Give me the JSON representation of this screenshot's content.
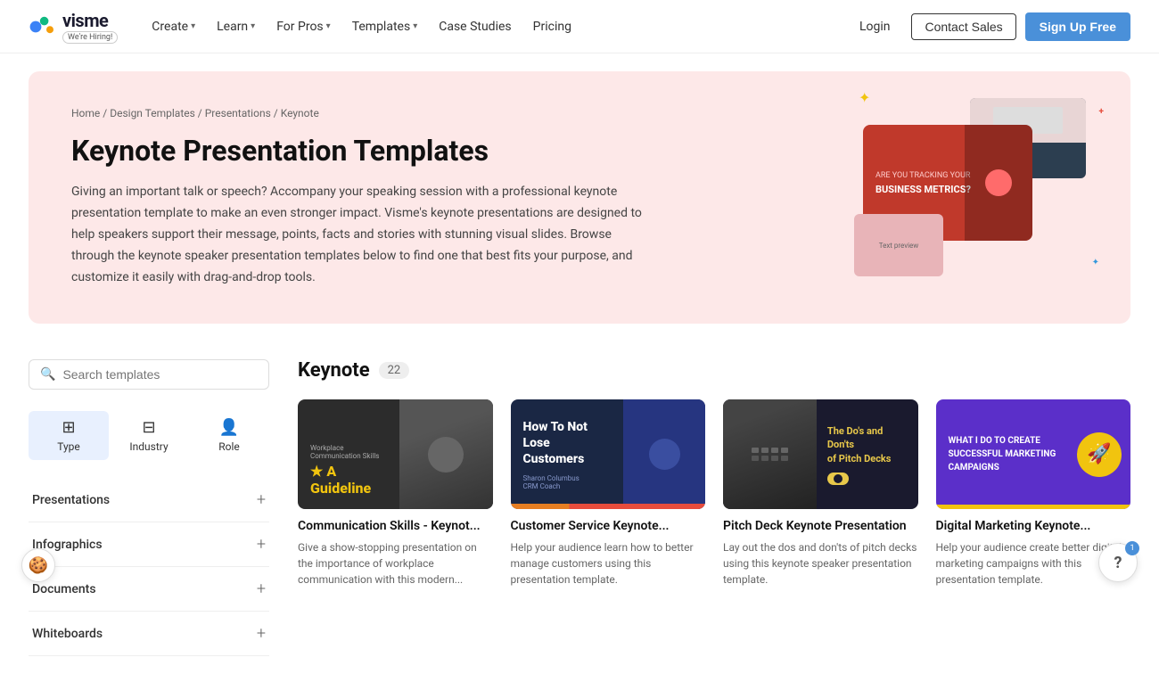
{
  "brand": {
    "name": "visme",
    "hiring_badge": "We're Hiring!",
    "logo_emoji": "🦎"
  },
  "nav": {
    "items": [
      {
        "label": "Create",
        "has_dropdown": true
      },
      {
        "label": "Learn",
        "has_dropdown": true
      },
      {
        "label": "For Pros",
        "has_dropdown": true
      },
      {
        "label": "Templates",
        "has_dropdown": true
      },
      {
        "label": "Case Studies",
        "has_dropdown": false
      },
      {
        "label": "Pricing",
        "has_dropdown": false
      }
    ],
    "login": "Login",
    "contact_sales": "Contact Sales",
    "sign_up": "Sign Up Free"
  },
  "hero": {
    "breadcrumb": [
      "Home",
      "Design Templates",
      "Presentations",
      "Keynote"
    ],
    "title": "Keynote Presentation Templates",
    "description": "Giving an important talk or speech? Accompany your speaking session with a professional keynote presentation template to make an even stronger impact. Visme's keynote presentations are designed to help speakers support their message, points, facts and stories with stunning visual slides. Browse through the keynote speaker presentation templates below to find one that best fits your purpose, and customize it easily with drag-and-drop tools."
  },
  "search": {
    "placeholder": "Search templates"
  },
  "filters": [
    {
      "label": "Type",
      "active": true
    },
    {
      "label": "Industry",
      "active": false
    },
    {
      "label": "Role",
      "active": false
    }
  ],
  "sidebar": {
    "items": [
      {
        "label": "Presentations",
        "expandable": true
      },
      {
        "label": "Infographics",
        "expandable": true
      },
      {
        "label": "Documents",
        "expandable": true
      },
      {
        "label": "Whiteboards",
        "expandable": true
      }
    ]
  },
  "section": {
    "title": "Keynote",
    "count": "22"
  },
  "templates": [
    {
      "id": 1,
      "title": "Communication Skills - Keynot...",
      "description": "Give a show-stopping presentation on the importance of workplace communication with this modern...",
      "thumb_type": "dark-meeting",
      "thumb_label": "Workplace Communication Skills",
      "thumb_highlight": "A Guideline"
    },
    {
      "id": 2,
      "title": "Customer Service Keynote...",
      "description": "Help your audience learn how to better manage customers using this presentation template.",
      "thumb_type": "dark-blue",
      "thumb_label": "How To Not Lose Customers",
      "thumb_author": "Sharon Columbus, CRM Coach"
    },
    {
      "id": 3,
      "title": "Pitch Deck Keynote Presentation",
      "description": "Lay out the dos and don'ts of pitch decks using this keynote speaker presentation template.",
      "thumb_type": "dark-audience",
      "thumb_label": "The Do's and Don'ts of Pitch Decks"
    },
    {
      "id": 4,
      "title": "Digital Marketing Keynote...",
      "description": "Help your audience create better digital marketing campaigns with this presentation template.",
      "thumb_type": "purple",
      "thumb_label": "What I Do To Create Successful Marketing Campaigns"
    }
  ],
  "help": {
    "icon": "?",
    "badge": "1"
  }
}
